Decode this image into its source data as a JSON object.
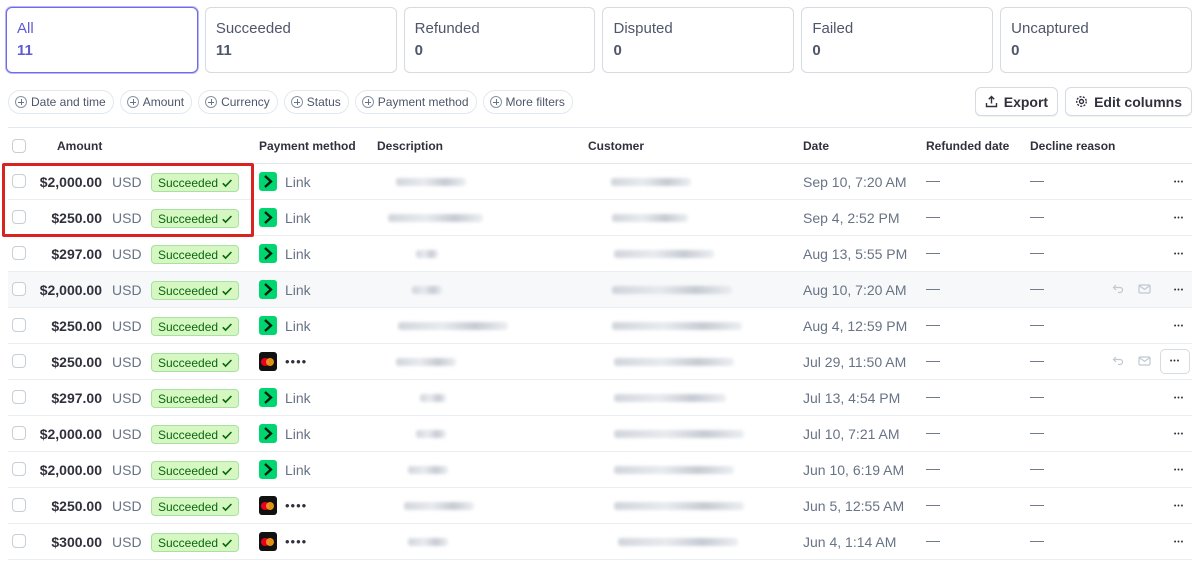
{
  "tabs": [
    {
      "label": "All",
      "count": "11",
      "active": true
    },
    {
      "label": "Succeeded",
      "count": "11"
    },
    {
      "label": "Refunded",
      "count": "0"
    },
    {
      "label": "Disputed",
      "count": "0"
    },
    {
      "label": "Failed",
      "count": "0"
    },
    {
      "label": "Uncaptured",
      "count": "0"
    }
  ],
  "filters": [
    "Date and time",
    "Amount",
    "Currency",
    "Status",
    "Payment method",
    "More filters"
  ],
  "actions": {
    "export_label": "Export",
    "edit_columns_label": "Edit columns"
  },
  "columns": {
    "amount": "Amount",
    "payment_method": "Payment method",
    "description": "Description",
    "customer": "Customer",
    "date": "Date",
    "refunded_date": "Refunded date",
    "decline_reason": "Decline reason"
  },
  "rows": [
    {
      "amount": "$2,000.00",
      "currency": "USD",
      "status": "Succeeded",
      "method_type": "link",
      "method_label": "Link",
      "date": "Sep 10, 7:20 AM",
      "refunded_date": "—",
      "decline_reason": "—"
    },
    {
      "amount": "$250.00",
      "currency": "USD",
      "status": "Succeeded",
      "method_type": "link",
      "method_label": "Link",
      "date": "Sep 4, 2:52 PM",
      "refunded_date": "—",
      "decline_reason": "—"
    },
    {
      "amount": "$297.00",
      "currency": "USD",
      "status": "Succeeded",
      "method_type": "link",
      "method_label": "Link",
      "date": "Aug 13, 5:55 PM",
      "refunded_date": "—",
      "decline_reason": "—"
    },
    {
      "amount": "$2,000.00",
      "currency": "USD",
      "status": "Succeeded",
      "method_type": "link",
      "method_label": "Link",
      "date": "Aug 10, 7:20 AM",
      "refunded_date": "—",
      "decline_reason": "—"
    },
    {
      "amount": "$250.00",
      "currency": "USD",
      "status": "Succeeded",
      "method_type": "link",
      "method_label": "Link",
      "date": "Aug 4, 12:59 PM",
      "refunded_date": "—",
      "decline_reason": "—"
    },
    {
      "amount": "$250.00",
      "currency": "USD",
      "status": "Succeeded",
      "method_type": "card",
      "method_label": "••••",
      "date": "Jul 29, 11:50 AM",
      "refunded_date": "—",
      "decline_reason": "—"
    },
    {
      "amount": "$297.00",
      "currency": "USD",
      "status": "Succeeded",
      "method_type": "link",
      "method_label": "Link",
      "date": "Jul 13, 4:54 PM",
      "refunded_date": "—",
      "decline_reason": "—"
    },
    {
      "amount": "$2,000.00",
      "currency": "USD",
      "status": "Succeeded",
      "method_type": "link",
      "method_label": "Link",
      "date": "Jul 10, 7:21 AM",
      "refunded_date": "—",
      "decline_reason": "—"
    },
    {
      "amount": "$2,000.00",
      "currency": "USD",
      "status": "Succeeded",
      "method_type": "link",
      "method_label": "Link",
      "date": "Jun 10, 6:19 AM",
      "refunded_date": "—",
      "decline_reason": "—"
    },
    {
      "amount": "$250.00",
      "currency": "USD",
      "status": "Succeeded",
      "method_type": "card",
      "method_label": "••••",
      "date": "Jun 5, 12:55 AM",
      "refunded_date": "—",
      "decline_reason": "—"
    },
    {
      "amount": "$300.00",
      "currency": "USD",
      "status": "Succeeded",
      "method_type": "card",
      "method_label": "••••",
      "date": "Jun 4, 1:14 AM",
      "refunded_date": "—",
      "decline_reason": "—"
    }
  ],
  "colors": {
    "accent": "#5f5bd6",
    "success_bg": "#d7f7c2",
    "success_text": "#05690d",
    "link_green": "#00d66f",
    "highlight_red": "#d92323"
  }
}
